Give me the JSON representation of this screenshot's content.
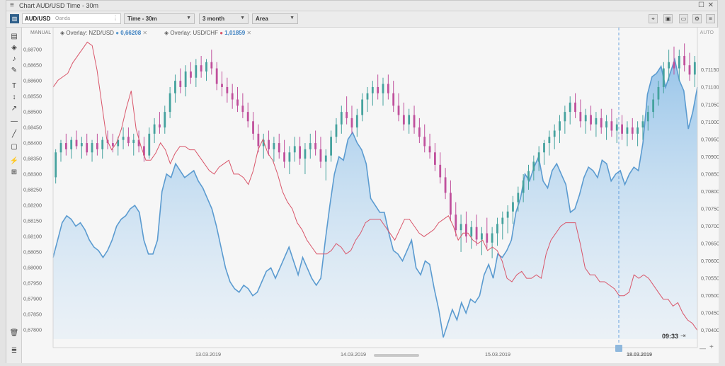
{
  "window": {
    "menu_icon": "menu-icon",
    "title": "Chart AUD/USD Time - 30m",
    "controls": [
      "maximize-icon",
      "close-icon"
    ]
  },
  "toolbar": {
    "symbol": "AUD/USD",
    "broker": "Oanda",
    "timeframe": "Time - 30m",
    "period": "3 month",
    "chart_type": "Area",
    "right_icons": [
      "crosshair-icon",
      "lock-icon",
      "screen-icon",
      "settings-icon",
      "menu-icon"
    ]
  },
  "sidebar": {
    "tools": [
      "bar-chart-icon",
      "layers-icon",
      "alert-bell-icon",
      "pencil-icon",
      "text-tool-icon",
      "vertical-line-icon",
      "arrow-icon",
      "horizontal-line-icon",
      "trend-line-icon",
      "rectangle-icon",
      "brush-icon",
      "ruler-icon"
    ],
    "trash": "trash-icon",
    "menu": "list-icon"
  },
  "labels": {
    "left_mode": "MANUAL",
    "right_mode": "AUTO",
    "current_time": "09:33",
    "zoom_minus": "—",
    "zoom_plus": "+"
  },
  "colors": {
    "nzd_series": "#5b9bd0",
    "chf_series": "#d9566a",
    "candle_up": "#45a29e",
    "candle_down": "#c0509c",
    "crosshair": "#4a90d9"
  },
  "chart_data": {
    "type": "area",
    "overlay_type": "candlestick",
    "title": "Chart AUD/USD Time - 30m",
    "x_tick_labels": [
      "13.03.2019",
      "14.03.2019",
      "15.03.2019",
      "18.03.2019"
    ],
    "left_axis": {
      "ticks": [
        "0,68700",
        "0,68650",
        "0,68600",
        "0,68550",
        "0,68500",
        "0,68450",
        "0,68400",
        "0,68350",
        "0,68300",
        "0,68250",
        "0,68200",
        "0,68150",
        "0,68100",
        "0,68050",
        "0,68000",
        "0,67950",
        "0,67900",
        "0,67850",
        "0,67800"
      ],
      "range": [
        0.6777,
        0.6873
      ]
    },
    "right_axis": {
      "ticks": [
        "0,71150",
        "0,71100",
        "0,71050",
        "0,71000",
        "0,70950",
        "0,70900",
        "0,70850",
        "0,70800",
        "0,70750",
        "0,70700",
        "0,70650",
        "0,70600",
        "0,70550",
        "0,70500",
        "0,70450",
        "0,70400"
      ],
      "range": [
        0.70375,
        0.71235
      ]
    },
    "overlays": [
      {
        "name": "Overlay: NZD/USD",
        "value": "0,66208"
      },
      {
        "name": "Overlay: USD/CHF",
        "value": "1,01859"
      }
    ],
    "candles": [
      [
        0.6829,
        0.6838,
        0.6827,
        0.6837
      ],
      [
        0.6837,
        0.6841,
        0.6834,
        0.684
      ],
      [
        0.684,
        0.6843,
        0.6836,
        0.6838
      ],
      [
        0.6838,
        0.6842,
        0.6835,
        0.6841
      ],
      [
        0.6841,
        0.6844,
        0.6838,
        0.6839
      ],
      [
        0.6839,
        0.6842,
        0.6835,
        0.684
      ],
      [
        0.684,
        0.6843,
        0.6836,
        0.6837
      ],
      [
        0.6837,
        0.6841,
        0.6834,
        0.684
      ],
      [
        0.684,
        0.6843,
        0.6836,
        0.6838
      ],
      [
        0.6838,
        0.6842,
        0.6835,
        0.6841
      ],
      [
        0.6841,
        0.6844,
        0.6838,
        0.684
      ],
      [
        0.684,
        0.6843,
        0.6837,
        0.6839
      ],
      [
        0.6839,
        0.6842,
        0.6836,
        0.6841
      ],
      [
        0.6841,
        0.6845,
        0.6838,
        0.6842
      ],
      [
        0.6842,
        0.6845,
        0.6839,
        0.684
      ],
      [
        0.684,
        0.6843,
        0.6836,
        0.6841
      ],
      [
        0.6841,
        0.6844,
        0.6837,
        0.6839
      ],
      [
        0.6839,
        0.6842,
        0.6834,
        0.6836
      ],
      [
        0.6836,
        0.6845,
        0.6835,
        0.6843
      ],
      [
        0.6843,
        0.6848,
        0.684,
        0.6846
      ],
      [
        0.6846,
        0.685,
        0.6843,
        0.6845
      ],
      [
        0.6845,
        0.6852,
        0.6843,
        0.685
      ],
      [
        0.685,
        0.6858,
        0.6848,
        0.6856
      ],
      [
        0.6856,
        0.6862,
        0.6853,
        0.686
      ],
      [
        0.686,
        0.6864,
        0.6856,
        0.6858
      ],
      [
        0.6858,
        0.6865,
        0.6855,
        0.6863
      ],
      [
        0.6863,
        0.6866,
        0.6859,
        0.6861
      ],
      [
        0.6861,
        0.6867,
        0.6858,
        0.6865
      ],
      [
        0.6865,
        0.6868,
        0.6861,
        0.6863
      ],
      [
        0.6863,
        0.6867,
        0.686,
        0.6866
      ],
      [
        0.6866,
        0.687,
        0.6862,
        0.6864
      ],
      [
        0.6864,
        0.6866,
        0.6857,
        0.6859
      ],
      [
        0.6859,
        0.6863,
        0.6855,
        0.6858
      ],
      [
        0.6858,
        0.6861,
        0.6853,
        0.6856
      ],
      [
        0.6856,
        0.6859,
        0.6851,
        0.6854
      ],
      [
        0.6854,
        0.6858,
        0.685,
        0.6852
      ],
      [
        0.6852,
        0.6856,
        0.6848,
        0.685
      ],
      [
        0.685,
        0.6853,
        0.6845,
        0.6847
      ],
      [
        0.6847,
        0.685,
        0.6841,
        0.6843
      ],
      [
        0.6843,
        0.6846,
        0.6837,
        0.6839
      ],
      [
        0.6839,
        0.6843,
        0.6835,
        0.6841
      ],
      [
        0.6841,
        0.6844,
        0.6836,
        0.6838
      ],
      [
        0.6838,
        0.6842,
        0.6834,
        0.684
      ],
      [
        0.684,
        0.6843,
        0.6835,
        0.6837
      ],
      [
        0.6837,
        0.6841,
        0.6832,
        0.6834
      ],
      [
        0.6834,
        0.6839,
        0.683,
        0.6837
      ],
      [
        0.6837,
        0.6842,
        0.6834,
        0.6839
      ],
      [
        0.6839,
        0.6842,
        0.6833,
        0.6835
      ],
      [
        0.6835,
        0.684,
        0.683,
        0.6838
      ],
      [
        0.6838,
        0.6843,
        0.6835,
        0.684
      ],
      [
        0.684,
        0.6844,
        0.6836,
        0.6838
      ],
      [
        0.6838,
        0.6842,
        0.6832,
        0.6834
      ],
      [
        0.6834,
        0.6838,
        0.6828,
        0.6836
      ],
      [
        0.6836,
        0.6844,
        0.6834,
        0.6842
      ],
      [
        0.6842,
        0.6848,
        0.684,
        0.6846
      ],
      [
        0.6846,
        0.6852,
        0.6843,
        0.685
      ],
      [
        0.685,
        0.6855,
        0.6846,
        0.6848
      ],
      [
        0.6848,
        0.6852,
        0.6843,
        0.6845
      ],
      [
        0.6845,
        0.6851,
        0.6842,
        0.6849
      ],
      [
        0.6849,
        0.6856,
        0.6847,
        0.6854
      ],
      [
        0.6854,
        0.6858,
        0.685,
        0.6856
      ],
      [
        0.6856,
        0.686,
        0.6852,
        0.6858
      ],
      [
        0.6858,
        0.6862,
        0.6854,
        0.6856
      ],
      [
        0.6856,
        0.6861,
        0.6852,
        0.6859
      ],
      [
        0.6859,
        0.6862,
        0.6854,
        0.6856
      ],
      [
        0.6856,
        0.686,
        0.685,
        0.6852
      ],
      [
        0.6852,
        0.6856,
        0.6847,
        0.6849
      ],
      [
        0.6849,
        0.6853,
        0.6844,
        0.6846
      ],
      [
        0.6846,
        0.6851,
        0.6843,
        0.6849
      ],
      [
        0.6849,
        0.6852,
        0.6843,
        0.6845
      ],
      [
        0.6845,
        0.6848,
        0.684,
        0.6842
      ],
      [
        0.6842,
        0.6846,
        0.6837,
        0.6839
      ],
      [
        0.6839,
        0.6843,
        0.6835,
        0.6837
      ],
      [
        0.6837,
        0.684,
        0.6831,
        0.6833
      ],
      [
        0.6833,
        0.6837,
        0.6827,
        0.6829
      ],
      [
        0.6829,
        0.6832,
        0.6822,
        0.6824
      ],
      [
        0.6824,
        0.6828,
        0.6815,
        0.6817
      ],
      [
        0.6817,
        0.6821,
        0.681,
        0.6812
      ],
      [
        0.6812,
        0.6817,
        0.6805,
        0.6814
      ],
      [
        0.6814,
        0.6818,
        0.6808,
        0.681
      ],
      [
        0.681,
        0.6815,
        0.6806,
        0.6813
      ],
      [
        0.6813,
        0.6817,
        0.6807,
        0.6809
      ],
      [
        0.6809,
        0.6813,
        0.6804,
        0.6811
      ],
      [
        0.6811,
        0.6816,
        0.6806,
        0.6808
      ],
      [
        0.6808,
        0.6813,
        0.6803,
        0.6811
      ],
      [
        0.6811,
        0.6816,
        0.6807,
        0.6814
      ],
      [
        0.6814,
        0.6818,
        0.6809,
        0.6816
      ],
      [
        0.6816,
        0.682,
        0.6811,
        0.6818
      ],
      [
        0.6818,
        0.6823,
        0.6814,
        0.6821
      ],
      [
        0.6821,
        0.6826,
        0.6818,
        0.6824
      ],
      [
        0.6824,
        0.683,
        0.6821,
        0.6828
      ],
      [
        0.6828,
        0.6833,
        0.6825,
        0.6831
      ],
      [
        0.6831,
        0.6836,
        0.6828,
        0.6834
      ],
      [
        0.6834,
        0.6839,
        0.6831,
        0.6837
      ],
      [
        0.6837,
        0.6841,
        0.6833,
        0.684
      ],
      [
        0.684,
        0.6844,
        0.6836,
        0.6842
      ],
      [
        0.6842,
        0.6846,
        0.6838,
        0.6844
      ],
      [
        0.6844,
        0.6849,
        0.684,
        0.6847
      ],
      [
        0.6847,
        0.6852,
        0.6843,
        0.685
      ],
      [
        0.685,
        0.6855,
        0.6846,
        0.6853
      ],
      [
        0.6853,
        0.6856,
        0.6848,
        0.685
      ],
      [
        0.685,
        0.6854,
        0.6845,
        0.6847
      ],
      [
        0.6847,
        0.6851,
        0.6843,
        0.6849
      ],
      [
        0.6849,
        0.6852,
        0.6844,
        0.6846
      ],
      [
        0.6846,
        0.685,
        0.6842,
        0.6848
      ],
      [
        0.6848,
        0.6851,
        0.6843,
        0.6845
      ],
      [
        0.6845,
        0.6849,
        0.6841,
        0.6847
      ],
      [
        0.6847,
        0.6851,
        0.6842,
        0.6844
      ],
      [
        0.6844,
        0.6848,
        0.684,
        0.6846
      ],
      [
        0.6846,
        0.6849,
        0.6841,
        0.6843
      ],
      [
        0.6843,
        0.6847,
        0.6839,
        0.6845
      ],
      [
        0.6845,
        0.6848,
        0.6841,
        0.6843
      ],
      [
        0.6843,
        0.6847,
        0.6839,
        0.6845
      ],
      [
        0.6845,
        0.6849,
        0.6841,
        0.6847
      ],
      [
        0.6847,
        0.6852,
        0.6844,
        0.685
      ],
      [
        0.685,
        0.6856,
        0.6848,
        0.6854
      ],
      [
        0.6854,
        0.686,
        0.6852,
        0.6858
      ],
      [
        0.6858,
        0.6866,
        0.6856,
        0.6864
      ],
      [
        0.6864,
        0.687,
        0.686,
        0.6866
      ],
      [
        0.6866,
        0.6871,
        0.6862,
        0.6864
      ],
      [
        0.6864,
        0.687,
        0.686,
        0.6868
      ],
      [
        0.6868,
        0.6872,
        0.6863,
        0.6865
      ],
      [
        0.6865,
        0.6869,
        0.686,
        0.6862
      ],
      [
        0.6862,
        0.6868,
        0.6858,
        0.6866
      ]
    ],
    "series": [
      {
        "name": "Overlay: NZD/USD",
        "axis": "right",
        "style": "area",
        "values": [
          0.7061,
          0.7066,
          0.7071,
          0.7073,
          0.7072,
          0.707,
          0.7071,
          0.7069,
          0.7066,
          0.7064,
          0.7063,
          0.7061,
          0.7063,
          0.7066,
          0.707,
          0.7072,
          0.7073,
          0.7075,
          0.7076,
          0.7074,
          0.7066,
          0.7062,
          0.7062,
          0.7066,
          0.708,
          0.7085,
          0.7084,
          0.7088,
          0.7086,
          0.7084,
          0.7085,
          0.7086,
          0.7083,
          0.7081,
          0.7078,
          0.7075,
          0.707,
          0.7064,
          0.7058,
          0.7054,
          0.7052,
          0.7051,
          0.7053,
          0.7052,
          0.705,
          0.7051,
          0.7054,
          0.7057,
          0.7058,
          0.7055,
          0.7058,
          0.7061,
          0.7064,
          0.706,
          0.7056,
          0.7061,
          0.7058,
          0.7055,
          0.7053,
          0.7055,
          0.7066,
          0.7076,
          0.7085,
          0.709,
          0.7089,
          0.7095,
          0.7097,
          0.7094,
          0.7092,
          0.7088,
          0.7078,
          0.7076,
          0.7074,
          0.7074,
          0.7068,
          0.7063,
          0.7062,
          0.706,
          0.7063,
          0.7066,
          0.7058,
          0.7056,
          0.706,
          0.7059,
          0.7052,
          0.7046,
          0.7038,
          0.7042,
          0.7046,
          0.7043,
          0.7048,
          0.7045,
          0.7049,
          0.7048,
          0.705,
          0.7056,
          0.7059,
          0.7055,
          0.7062,
          0.7061,
          0.7063,
          0.7066,
          0.7074,
          0.7078,
          0.7085,
          0.7083,
          0.7087,
          0.709,
          0.7083,
          0.7081,
          0.7086,
          0.7088,
          0.7085,
          0.7082,
          0.7074,
          0.7075,
          0.7079,
          0.7084,
          0.7087,
          0.7086,
          0.7084,
          0.7089,
          0.7088,
          0.7083,
          0.7085,
          0.7086,
          0.7082,
          0.7085,
          0.7087,
          0.7086,
          0.7094,
          0.7108,
          0.7113,
          0.7114,
          0.7116,
          0.711,
          0.7114,
          0.7118,
          0.7112,
          0.7109,
          0.7098,
          0.7103,
          0.711
        ],
        "color": "#5b9bd0"
      },
      {
        "name": "Overlay: USD/CHF",
        "axis": "right",
        "style": "line",
        "values": [
          0.711,
          0.7112,
          0.7113,
          0.7114,
          0.7117,
          0.7119,
          0.7121,
          0.7123,
          0.7122,
          0.7115,
          0.7105,
          0.7095,
          0.7092,
          0.7094,
          0.7098,
          0.7104,
          0.7109,
          0.7098,
          0.7093,
          0.7089,
          0.7089,
          0.7091,
          0.7094,
          0.7092,
          0.7088,
          0.7091,
          0.7093,
          0.7093,
          0.7092,
          0.7092,
          0.709,
          0.7088,
          0.7086,
          0.7085,
          0.7087,
          0.7088,
          0.7089,
          0.7085,
          0.7085,
          0.7084,
          0.7082,
          0.7086,
          0.7092,
          0.7095,
          0.7091,
          0.7089,
          0.7085,
          0.708,
          0.7077,
          0.7075,
          0.7071,
          0.7069,
          0.7066,
          0.7064,
          0.7062,
          0.7062,
          0.7062,
          0.7063,
          0.7065,
          0.7064,
          0.7062,
          0.7063,
          0.7066,
          0.7068,
          0.7071,
          0.7072,
          0.7072,
          0.7072,
          0.707,
          0.7068,
          0.7066,
          0.7069,
          0.7072,
          0.7072,
          0.707,
          0.7068,
          0.7067,
          0.7068,
          0.7069,
          0.7071,
          0.7072,
          0.7073,
          0.707,
          0.7066,
          0.7068,
          0.7068,
          0.7066,
          0.7065,
          0.7066,
          0.7063,
          0.7064,
          0.7063,
          0.706,
          0.7055,
          0.7054,
          0.7056,
          0.7057,
          0.7055,
          0.7055,
          0.7056,
          0.7055,
          0.7062,
          0.7066,
          0.7068,
          0.707,
          0.7071,
          0.7071,
          0.7071,
          0.7065,
          0.7058,
          0.7056,
          0.7056,
          0.7054,
          0.7054,
          0.7053,
          0.7052,
          0.705,
          0.705,
          0.7051,
          0.7056,
          0.7055,
          0.7056,
          0.7055,
          0.7053,
          0.7051,
          0.7049,
          0.7049,
          0.7047,
          0.7048,
          0.7045,
          0.7043,
          0.7042,
          0.704
        ],
        "color": "#d9566a"
      }
    ],
    "x_labels_positions_note": "",
    "grid": false,
    "legend": "top-left"
  }
}
